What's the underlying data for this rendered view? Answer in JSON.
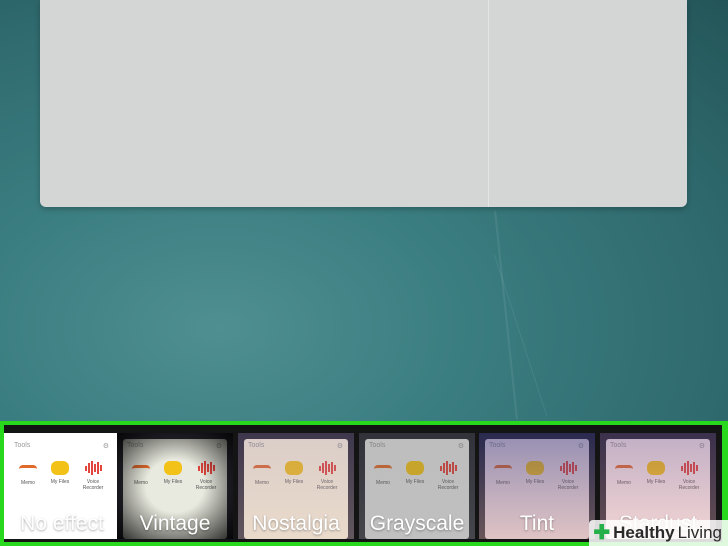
{
  "filters": [
    {
      "label": "No effect",
      "selected": true
    },
    {
      "label": "Vintage",
      "selected": false
    },
    {
      "label": "Nostalgia",
      "selected": false
    },
    {
      "label": "Grayscale",
      "selected": false
    },
    {
      "label": "Tint",
      "selected": false
    },
    {
      "label": "Stardust",
      "selected": false
    }
  ],
  "thumbnail": {
    "title": "Tools",
    "apps": [
      "Memo",
      "My Files",
      "Voice Recorder"
    ]
  },
  "watermark": {
    "part1": "Healthy",
    "part2": "Living"
  },
  "colors": {
    "highlight_border": "#27d81d",
    "accent_orange": "#e06a2b",
    "accent_yellow": "#f2c219",
    "accent_red": "#e2453c"
  }
}
